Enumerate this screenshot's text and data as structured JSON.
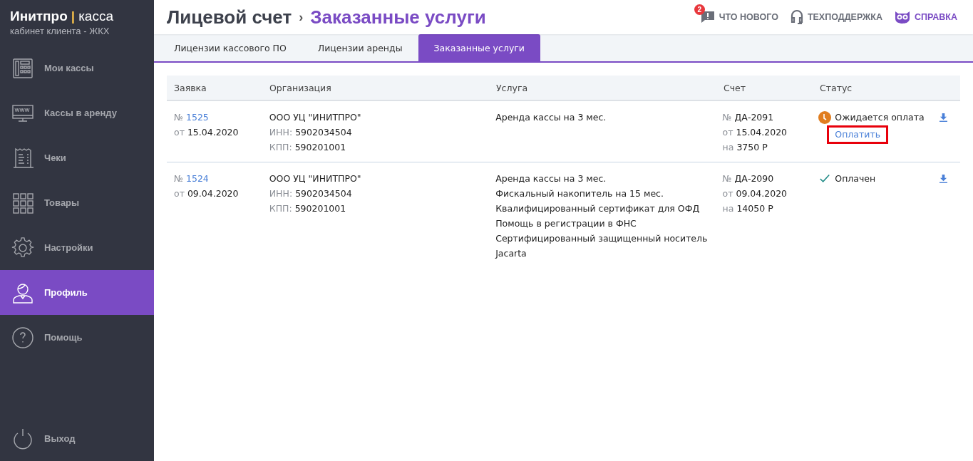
{
  "brand": {
    "name": "Инитпро",
    "separator": "|",
    "product": "касса",
    "subtitle": "кабинет клиента - ЖКХ"
  },
  "sidebar": {
    "items": [
      {
        "kind": "register",
        "label": "Мои кассы",
        "selected": false
      },
      {
        "kind": "monitor",
        "label": "Кассы в аренду",
        "selected": false
      },
      {
        "kind": "receipt",
        "label": "Чеки",
        "selected": false
      },
      {
        "kind": "grid",
        "label": "Товары",
        "selected": false
      },
      {
        "kind": "gear",
        "label": "Настройки",
        "selected": false
      },
      {
        "kind": "person",
        "label": "Профиль",
        "selected": true
      },
      {
        "kind": "help",
        "label": "Помощь",
        "selected": false
      }
    ],
    "logout": {
      "label": "Выход"
    }
  },
  "header": {
    "breadcrumb": "Лицевой счет",
    "separator": "›",
    "title": "Заказанные услуги",
    "links": [
      {
        "kind": "news",
        "label": "ЧТО НОВОГО",
        "badge": "2"
      },
      {
        "kind": "support",
        "label": "ТЕХПОДДЕРЖКА"
      },
      {
        "kind": "help",
        "label": "СПРАВКА"
      }
    ]
  },
  "tabs": [
    {
      "label": "Лицензии кассового ПО",
      "selected": false
    },
    {
      "label": "Лицензии аренды",
      "selected": false
    },
    {
      "label": "Заказанные услуги",
      "selected": true
    }
  ],
  "table": {
    "columns": [
      "Заявка",
      "Организация",
      "Услуга",
      "Счет",
      "Статус"
    ],
    "rows": [
      {
        "order": {
          "prefix": "№",
          "number": "1525",
          "date_prefix": "от",
          "date": "15.04.2020"
        },
        "org": {
          "name": "ООО УЦ \"ИНИТПРО\"",
          "inn_label": "ИНН:",
          "inn": "5902034504",
          "kpp_label": "КПП:",
          "kpp": "590201001"
        },
        "services": [
          "Аренда кассы на 3 мес."
        ],
        "invoice": {
          "prefix": "№",
          "number": "ДА-2091",
          "date_prefix": "от",
          "date": "15.04.2020",
          "amount_prefix": "на",
          "amount": "3750 Р"
        },
        "status": {
          "kind": "pending",
          "label": "Ожидается оплата",
          "action": "Оплатить",
          "highlighted": true
        }
      },
      {
        "order": {
          "prefix": "№",
          "number": "1524",
          "date_prefix": "от",
          "date": "09.04.2020"
        },
        "org": {
          "name": "ООО УЦ \"ИНИТПРО\"",
          "inn_label": "ИНН:",
          "inn": "5902034504",
          "kpp_label": "КПП:",
          "kpp": "590201001"
        },
        "services": [
          "Аренда кассы на 3 мес.",
          "Фискальный накопитель на 15 мес.",
          "Квалифицированный сертификат для ОФД",
          "Помощь в регистрации в ФНС",
          "Сертифицированный защищенный носитель",
          "Jacarta"
        ],
        "invoice": {
          "prefix": "№",
          "number": "ДА-2090",
          "date_prefix": "от",
          "date": "09.04.2020",
          "amount_prefix": "на",
          "amount": "14050 Р"
        },
        "status": {
          "kind": "paid",
          "label": "Оплачен"
        }
      }
    ]
  }
}
